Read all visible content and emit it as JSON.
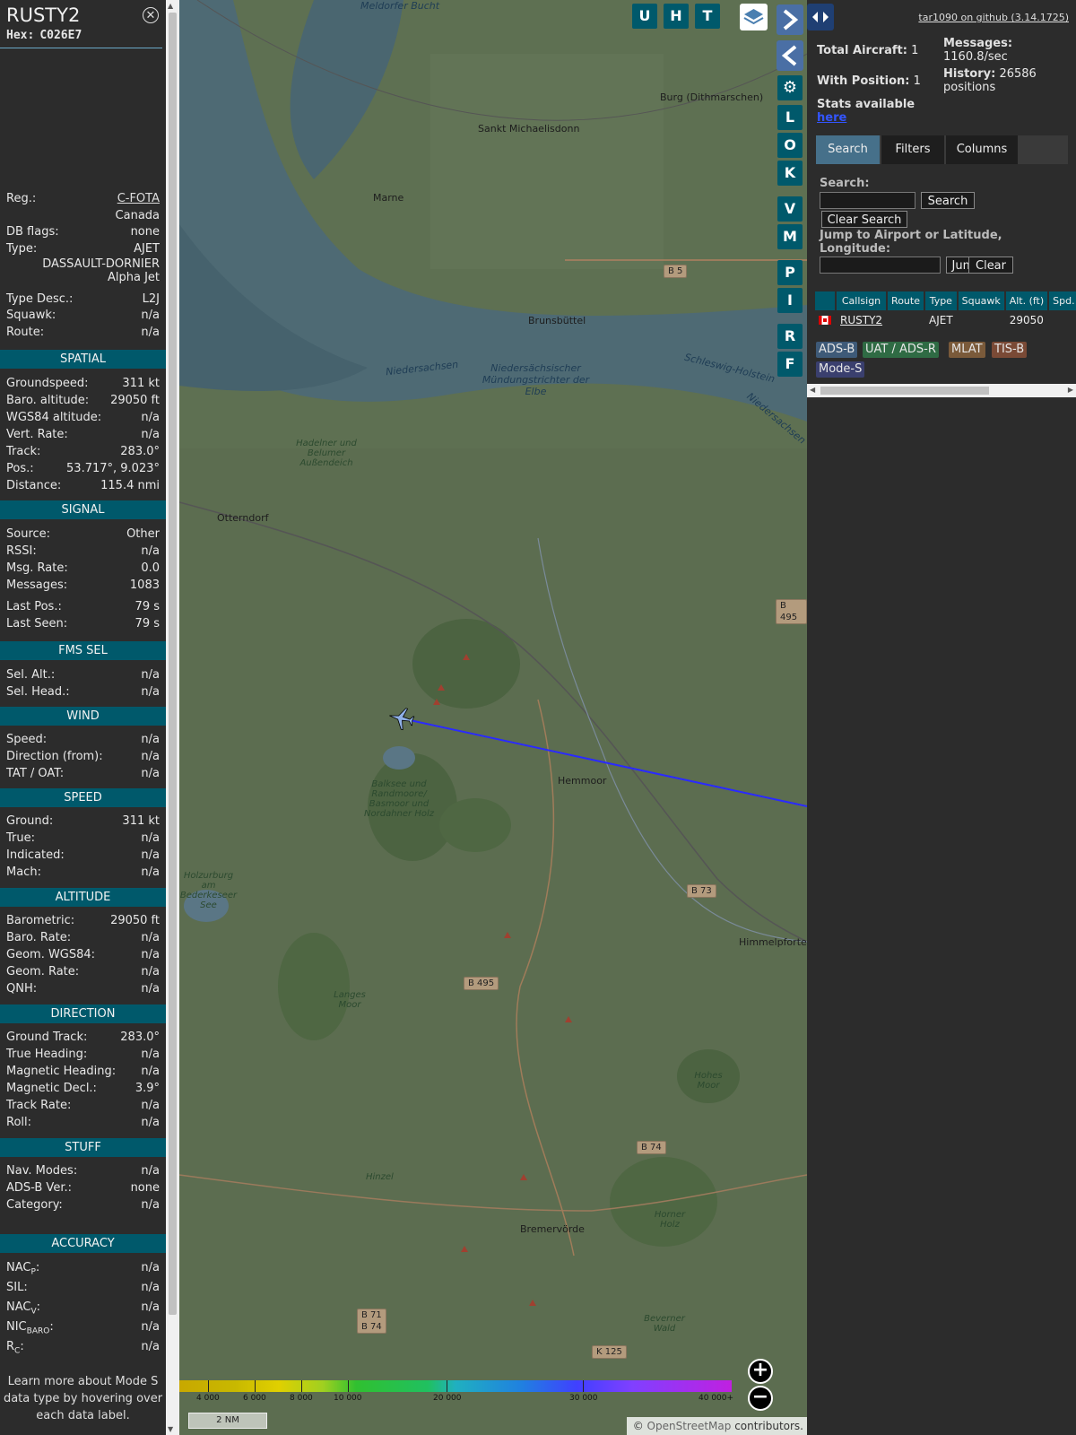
{
  "info": {
    "callsign": "RUSTY2",
    "hex_label": "Hex:",
    "hex": "C026E7",
    "close_glyph": "✕",
    "reg_label": "Reg.:",
    "reg": "C-FOTA",
    "country": "Canada",
    "dbflags_label": "DB flags:",
    "dbflags": "none",
    "type_label": "Type:",
    "type": "AJET",
    "type_full": "DASSAULT-DORNIER\nAlpha Jet",
    "typedesc_label": "Type Desc.:",
    "typedesc": "L2J",
    "squawk_label": "Squawk:",
    "squawk": "n/a",
    "route_label": "Route:",
    "route": "n/a"
  },
  "sections": {
    "spatial": "SPATIAL",
    "signal": "SIGNAL",
    "fmssel": "FMS SEL",
    "wind": "WIND",
    "speed": "SPEED",
    "altitude": "ALTITUDE",
    "direction": "DIRECTION",
    "stuff": "STUFF",
    "accuracy": "ACCURACY"
  },
  "spatial": [
    {
      "k": "Groundspeed:",
      "v": "311 kt"
    },
    {
      "k": "Baro. altitude:",
      "v": "29050 ft"
    },
    {
      "k": "WGS84 altitude:",
      "v": "n/a"
    },
    {
      "k": "Vert. Rate:",
      "v": "n/a"
    },
    {
      "k": "Track:",
      "v": "283.0°"
    },
    {
      "k": "Pos.:",
      "v": "53.717°, 9.023°"
    },
    {
      "k": "Distance:",
      "v": "115.4 nmi"
    }
  ],
  "signal": [
    {
      "k": "Source:",
      "v": "Other"
    },
    {
      "k": "RSSI:",
      "v": "n/a"
    },
    {
      "k": "Msg. Rate:",
      "v": "0.0"
    },
    {
      "k": "Messages:",
      "v": "1083"
    },
    {
      "k": "Last Pos.:",
      "v": "79 s"
    },
    {
      "k": "Last Seen:",
      "v": "79 s"
    }
  ],
  "fmssel": [
    {
      "k": "Sel. Alt.:",
      "v": "n/a"
    },
    {
      "k": "Sel. Head.:",
      "v": "n/a"
    }
  ],
  "wind": [
    {
      "k": "Speed:",
      "v": "n/a"
    },
    {
      "k": "Direction (from):",
      "v": "n/a"
    },
    {
      "k": "TAT / OAT:",
      "v": "n/a"
    }
  ],
  "speed": [
    {
      "k": "Ground:",
      "v": "311 kt"
    },
    {
      "k": "True:",
      "v": "n/a"
    },
    {
      "k": "Indicated:",
      "v": "n/a"
    },
    {
      "k": "Mach:",
      "v": "n/a"
    }
  ],
  "altitude": [
    {
      "k": "Barometric:",
      "v": "29050 ft"
    },
    {
      "k": "Baro. Rate:",
      "v": "n/a"
    },
    {
      "k": "Geom. WGS84:",
      "v": "n/a"
    },
    {
      "k": "Geom. Rate:",
      "v": "n/a"
    },
    {
      "k": "QNH:",
      "v": "n/a"
    }
  ],
  "direction": [
    {
      "k": "Ground Track:",
      "v": "283.0°"
    },
    {
      "k": "True Heading:",
      "v": "n/a"
    },
    {
      "k": "Magnetic Heading:",
      "v": "n/a"
    },
    {
      "k": "Magnetic Decl.:",
      "v": "3.9°"
    },
    {
      "k": "Track Rate:",
      "v": "n/a"
    },
    {
      "k": "Roll:",
      "v": "n/a"
    }
  ],
  "stuff": [
    {
      "k": "Nav. Modes:",
      "v": "n/a"
    },
    {
      "k": "ADS-B Ver.:",
      "v": "none"
    },
    {
      "k": "Category:",
      "v": "n/a"
    }
  ],
  "accuracy": [
    {
      "k": "NAC",
      "sub": "P",
      "v": "n/a"
    },
    {
      "k": "SIL:",
      "sub": "",
      "v": "n/a"
    },
    {
      "k": "NAC",
      "sub": "V",
      "v": "n/a"
    },
    {
      "k": "NIC",
      "sub": "BARO",
      "v": "n/a"
    },
    {
      "k": "R",
      "sub": "C",
      "v": "n/a"
    }
  ],
  "footnote": "Learn more about Mode S data type by hovering over each data label.",
  "map": {
    "places": [
      "Burg (Dithmarschen)",
      "Sankt Michaelisdonn",
      "Marne",
      "Brunsbüttel",
      "Otterndorf",
      "Hemmoor",
      "Himmelpforten",
      "Bremervörde",
      "Meldorfer Bucht"
    ],
    "nature": [
      "Niedersächsischer Mündungstrichter der Elbe",
      "Hadelner und Belumer Außendeich",
      "Balksee und Randmoore/ Basmoor und Nordahner Holz",
      "Holzurburg am Bederkeseer See",
      "Langes Moor",
      "Hohes Moor",
      "Hinzel",
      "Horner Holz",
      "Beverner Wald"
    ],
    "state_labels": [
      "Niedersachsen",
      "Schleswig-Holstein",
      "Niedersachsen"
    ],
    "roads": [
      "B 5",
      "B 495",
      "B 73",
      "B 495",
      "B 74",
      "B 71\nB 74",
      "K 125"
    ],
    "buttons": [
      "U",
      "H",
      "T",
      "L",
      "O",
      "K",
      "V",
      "M",
      "P",
      "I",
      "R",
      "F"
    ],
    "zoom_in": "+",
    "zoom_out": "−",
    "scale": "2 NM",
    "attribution_symbol": "©",
    "attribution_link": "OpenStreetMap",
    "attribution_text": "contributors.",
    "colorbar_labels": [
      "4 000",
      "6 000",
      "8 000",
      "10 000",
      "20 000",
      "30 000",
      "40 000+"
    ]
  },
  "right": {
    "github": "tar1090 on github (3.14.1725)",
    "total_label": "Total Aircraft:",
    "total": "1",
    "withpos_label": "With Position:",
    "withpos": "1",
    "messages_label": "Messages:",
    "messages_rate": "1160.8/sec",
    "history_label": "History:",
    "history_count": "26586",
    "history_unit": "positions",
    "stats_label": "Stats available",
    "stats_link": "here",
    "tabs": [
      "Search",
      "Filters",
      "Columns"
    ],
    "search_label": "Search:",
    "search_btn": "Search",
    "clear_search_btn": "Clear Search",
    "jump_label": "Jump to Airport or Latitude, Longitude:",
    "jump_btn": "Jump",
    "clear_btn": "Clear",
    "columns": [
      "",
      "Callsign",
      "Route",
      "Type",
      "Squawk",
      "Alt. (ft)",
      "Spd."
    ],
    "rows": [
      {
        "callsign": "RUSTY2",
        "route": "",
        "type": "AJET",
        "squawk": "",
        "alt": "29050",
        "spd": ""
      }
    ],
    "sources": [
      {
        "label": "ADS-B",
        "bg": "#3e5a78",
        "fg": "#e6e6e6"
      },
      {
        "label": "UAT / ADS-R",
        "bg": "#2f6b44",
        "fg": "#e6e6e6"
      },
      {
        "label": "MLAT",
        "bg": "#7a5a3a",
        "fg": "#e6e6e6"
      },
      {
        "label": "TIS-B",
        "bg": "#7a4a36",
        "fg": "#e6e6e6"
      },
      {
        "label": "Mode-S",
        "bg": "#3a3f6e",
        "fg": "#e6e6e6"
      }
    ]
  },
  "colors": {
    "section": "#00596b",
    "accent": "#4a6fa5",
    "track": "#2a2aff"
  }
}
